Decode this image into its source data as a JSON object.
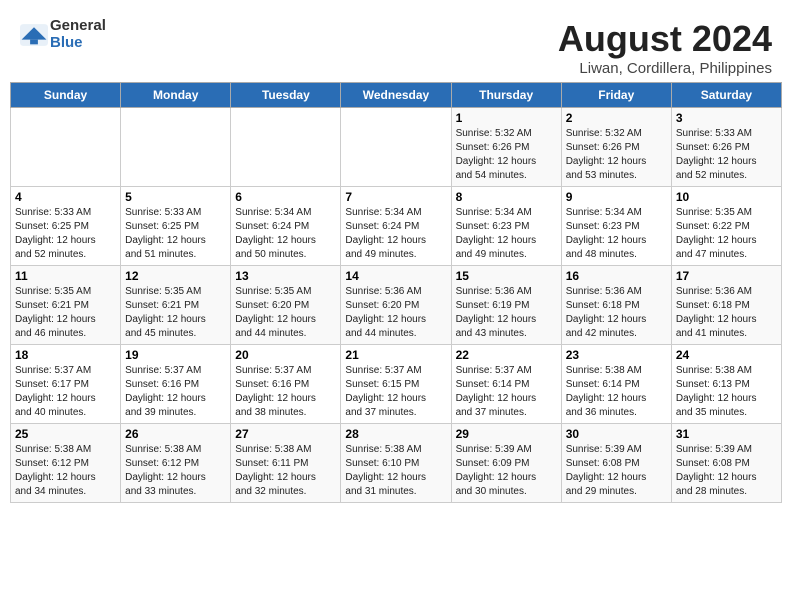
{
  "logo": {
    "general": "General",
    "blue": "Blue"
  },
  "title": "August 2024",
  "subtitle": "Liwan, Cordillera, Philippines",
  "days_of_week": [
    "Sunday",
    "Monday",
    "Tuesday",
    "Wednesday",
    "Thursday",
    "Friday",
    "Saturday"
  ],
  "weeks": [
    [
      {
        "day": "",
        "info": ""
      },
      {
        "day": "",
        "info": ""
      },
      {
        "day": "",
        "info": ""
      },
      {
        "day": "",
        "info": ""
      },
      {
        "day": "1",
        "info": "Sunrise: 5:32 AM\nSunset: 6:26 PM\nDaylight: 12 hours\nand 54 minutes."
      },
      {
        "day": "2",
        "info": "Sunrise: 5:32 AM\nSunset: 6:26 PM\nDaylight: 12 hours\nand 53 minutes."
      },
      {
        "day": "3",
        "info": "Sunrise: 5:33 AM\nSunset: 6:26 PM\nDaylight: 12 hours\nand 52 minutes."
      }
    ],
    [
      {
        "day": "4",
        "info": "Sunrise: 5:33 AM\nSunset: 6:25 PM\nDaylight: 12 hours\nand 52 minutes."
      },
      {
        "day": "5",
        "info": "Sunrise: 5:33 AM\nSunset: 6:25 PM\nDaylight: 12 hours\nand 51 minutes."
      },
      {
        "day": "6",
        "info": "Sunrise: 5:34 AM\nSunset: 6:24 PM\nDaylight: 12 hours\nand 50 minutes."
      },
      {
        "day": "7",
        "info": "Sunrise: 5:34 AM\nSunset: 6:24 PM\nDaylight: 12 hours\nand 49 minutes."
      },
      {
        "day": "8",
        "info": "Sunrise: 5:34 AM\nSunset: 6:23 PM\nDaylight: 12 hours\nand 49 minutes."
      },
      {
        "day": "9",
        "info": "Sunrise: 5:34 AM\nSunset: 6:23 PM\nDaylight: 12 hours\nand 48 minutes."
      },
      {
        "day": "10",
        "info": "Sunrise: 5:35 AM\nSunset: 6:22 PM\nDaylight: 12 hours\nand 47 minutes."
      }
    ],
    [
      {
        "day": "11",
        "info": "Sunrise: 5:35 AM\nSunset: 6:21 PM\nDaylight: 12 hours\nand 46 minutes."
      },
      {
        "day": "12",
        "info": "Sunrise: 5:35 AM\nSunset: 6:21 PM\nDaylight: 12 hours\nand 45 minutes."
      },
      {
        "day": "13",
        "info": "Sunrise: 5:35 AM\nSunset: 6:20 PM\nDaylight: 12 hours\nand 44 minutes."
      },
      {
        "day": "14",
        "info": "Sunrise: 5:36 AM\nSunset: 6:20 PM\nDaylight: 12 hours\nand 44 minutes."
      },
      {
        "day": "15",
        "info": "Sunrise: 5:36 AM\nSunset: 6:19 PM\nDaylight: 12 hours\nand 43 minutes."
      },
      {
        "day": "16",
        "info": "Sunrise: 5:36 AM\nSunset: 6:18 PM\nDaylight: 12 hours\nand 42 minutes."
      },
      {
        "day": "17",
        "info": "Sunrise: 5:36 AM\nSunset: 6:18 PM\nDaylight: 12 hours\nand 41 minutes."
      }
    ],
    [
      {
        "day": "18",
        "info": "Sunrise: 5:37 AM\nSunset: 6:17 PM\nDaylight: 12 hours\nand 40 minutes."
      },
      {
        "day": "19",
        "info": "Sunrise: 5:37 AM\nSunset: 6:16 PM\nDaylight: 12 hours\nand 39 minutes."
      },
      {
        "day": "20",
        "info": "Sunrise: 5:37 AM\nSunset: 6:16 PM\nDaylight: 12 hours\nand 38 minutes."
      },
      {
        "day": "21",
        "info": "Sunrise: 5:37 AM\nSunset: 6:15 PM\nDaylight: 12 hours\nand 37 minutes."
      },
      {
        "day": "22",
        "info": "Sunrise: 5:37 AM\nSunset: 6:14 PM\nDaylight: 12 hours\nand 37 minutes."
      },
      {
        "day": "23",
        "info": "Sunrise: 5:38 AM\nSunset: 6:14 PM\nDaylight: 12 hours\nand 36 minutes."
      },
      {
        "day": "24",
        "info": "Sunrise: 5:38 AM\nSunset: 6:13 PM\nDaylight: 12 hours\nand 35 minutes."
      }
    ],
    [
      {
        "day": "25",
        "info": "Sunrise: 5:38 AM\nSunset: 6:12 PM\nDaylight: 12 hours\nand 34 minutes."
      },
      {
        "day": "26",
        "info": "Sunrise: 5:38 AM\nSunset: 6:12 PM\nDaylight: 12 hours\nand 33 minutes."
      },
      {
        "day": "27",
        "info": "Sunrise: 5:38 AM\nSunset: 6:11 PM\nDaylight: 12 hours\nand 32 minutes."
      },
      {
        "day": "28",
        "info": "Sunrise: 5:38 AM\nSunset: 6:10 PM\nDaylight: 12 hours\nand 31 minutes."
      },
      {
        "day": "29",
        "info": "Sunrise: 5:39 AM\nSunset: 6:09 PM\nDaylight: 12 hours\nand 30 minutes."
      },
      {
        "day": "30",
        "info": "Sunrise: 5:39 AM\nSunset: 6:08 PM\nDaylight: 12 hours\nand 29 minutes."
      },
      {
        "day": "31",
        "info": "Sunrise: 5:39 AM\nSunset: 6:08 PM\nDaylight: 12 hours\nand 28 minutes."
      }
    ]
  ]
}
